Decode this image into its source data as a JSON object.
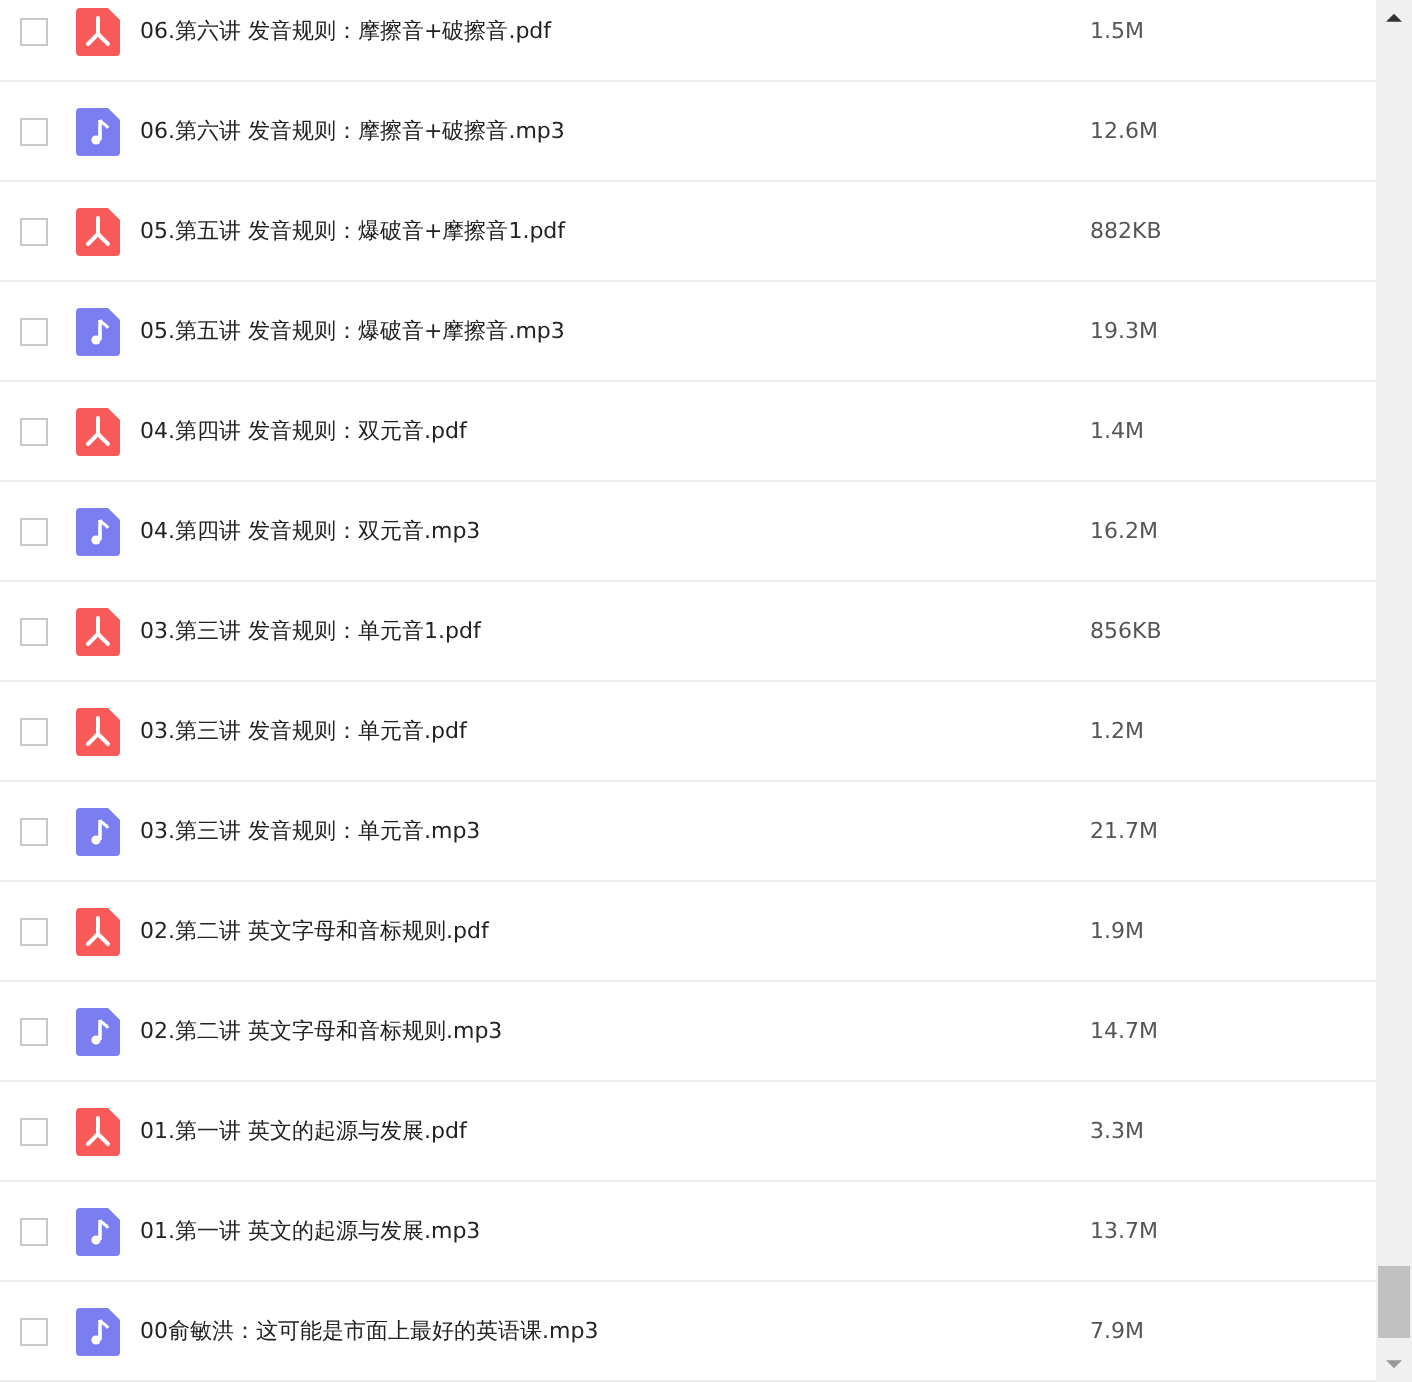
{
  "files": [
    {
      "kind": "pdf",
      "name": "06.第六讲 发音规则：摩擦音+破擦音.pdf",
      "size": "1.5M",
      "checked": false
    },
    {
      "kind": "audio",
      "name": "06.第六讲 发音规则：摩擦音+破擦音.mp3",
      "size": "12.6M",
      "checked": false
    },
    {
      "kind": "pdf",
      "name": "05.第五讲 发音规则：爆破音+摩擦音1.pdf",
      "size": "882KB",
      "checked": false
    },
    {
      "kind": "audio",
      "name": "05.第五讲 发音规则：爆破音+摩擦音.mp3",
      "size": "19.3M",
      "checked": false
    },
    {
      "kind": "pdf",
      "name": "04.第四讲 发音规则：双元音.pdf",
      "size": "1.4M",
      "checked": false
    },
    {
      "kind": "audio",
      "name": "04.第四讲 发音规则：双元音.mp3",
      "size": "16.2M",
      "checked": false
    },
    {
      "kind": "pdf",
      "name": "03.第三讲 发音规则：单元音1.pdf",
      "size": "856KB",
      "checked": false
    },
    {
      "kind": "pdf",
      "name": "03.第三讲 发音规则：单元音.pdf",
      "size": "1.2M",
      "checked": false
    },
    {
      "kind": "audio",
      "name": "03.第三讲 发音规则：单元音.mp3",
      "size": "21.7M",
      "checked": false
    },
    {
      "kind": "pdf",
      "name": "02.第二讲 英文字母和音标规则.pdf",
      "size": "1.9M",
      "checked": false
    },
    {
      "kind": "audio",
      "name": "02.第二讲 英文字母和音标规则.mp3",
      "size": "14.7M",
      "checked": false
    },
    {
      "kind": "pdf",
      "name": "01.第一讲 英文的起源与发展.pdf",
      "size": "3.3M",
      "checked": false
    },
    {
      "kind": "audio",
      "name": "01.第一讲 英文的起源与发展.mp3",
      "size": "13.7M",
      "checked": false
    },
    {
      "kind": "audio",
      "name": "00俞敏洪：这可能是市面上最好的英语课.mp3",
      "size": "7.9M",
      "checked": false
    }
  ]
}
